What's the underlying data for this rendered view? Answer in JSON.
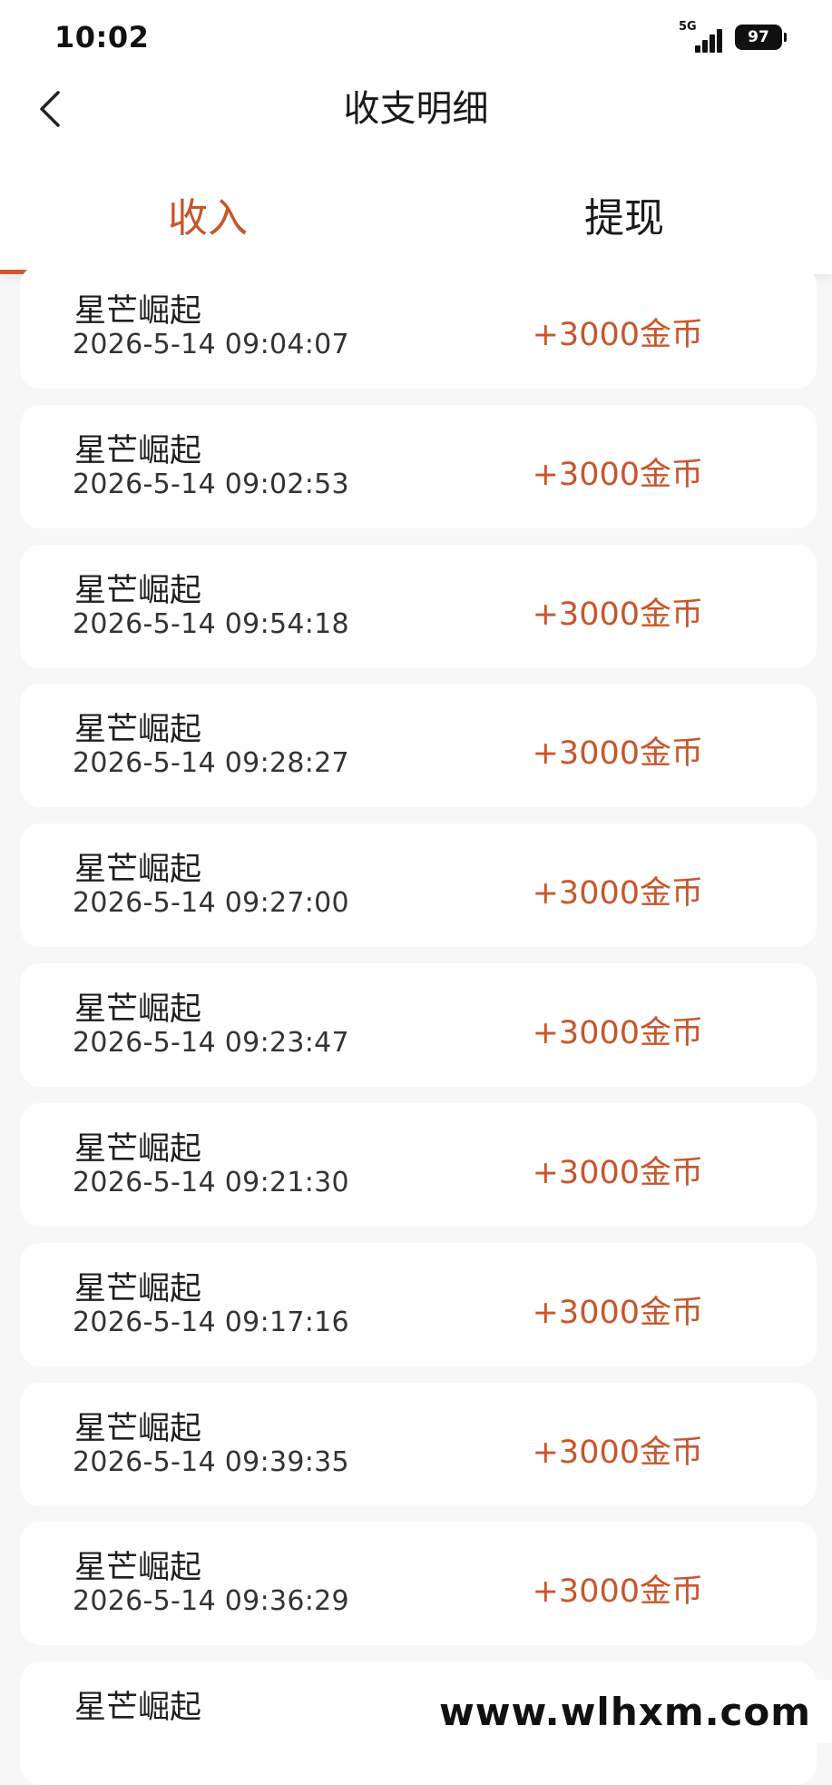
{
  "status_bar": {
    "time": "10:02",
    "network": "5G",
    "battery": "97"
  },
  "header": {
    "title": "收支明细"
  },
  "tabs": [
    {
      "label": "收入",
      "active": true
    },
    {
      "label": "提现",
      "active": false
    }
  ],
  "records": [
    {
      "title": "星芒崛起",
      "time": "2026-5-14 09:04:07",
      "amount": "+3000金币"
    },
    {
      "title": "星芒崛起",
      "time": "2026-5-14 09:02:53",
      "amount": "+3000金币"
    },
    {
      "title": "星芒崛起",
      "time": "2026-5-14 09:54:18",
      "amount": "+3000金币"
    },
    {
      "title": "星芒崛起",
      "time": "2026-5-14 09:28:27",
      "amount": "+3000金币"
    },
    {
      "title": "星芒崛起",
      "time": "2026-5-14 09:27:00",
      "amount": "+3000金币"
    },
    {
      "title": "星芒崛起",
      "time": "2026-5-14 09:23:47",
      "amount": "+3000金币"
    },
    {
      "title": "星芒崛起",
      "time": "2026-5-14 09:21:30",
      "amount": "+3000金币"
    },
    {
      "title": "星芒崛起",
      "time": "2026-5-14 09:17:16",
      "amount": "+3000金币"
    },
    {
      "title": "星芒崛起",
      "time": "2026-5-14 09:39:35",
      "amount": "+3000金币"
    },
    {
      "title": "星芒崛起",
      "time": "2026-5-14 09:36:29",
      "amount": "+3000金币"
    },
    {
      "title": "星芒崛起",
      "time": "",
      "amount": ""
    }
  ],
  "watermark": "www.wlhxm.com",
  "colors": {
    "accent": "#c9552a",
    "tab_indicator": "#d35a30",
    "page_background": "#f7f7f7"
  }
}
